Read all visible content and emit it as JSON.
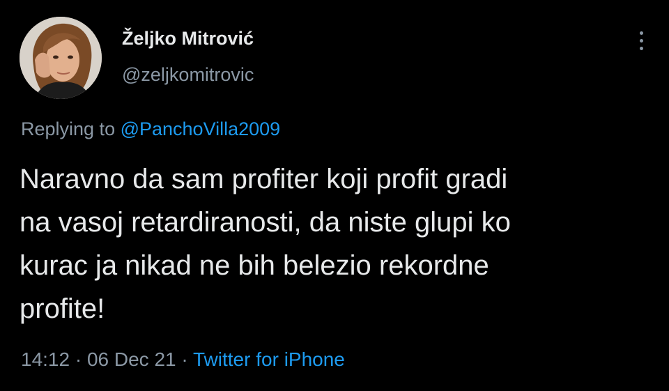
{
  "author": {
    "display_name": "Željko Mitrović",
    "handle": "@zeljkomitrovic"
  },
  "reply": {
    "prefix": "Replying to ",
    "mention": "@PanchoVilla2009"
  },
  "tweet": {
    "lines": [
      "Naravno da sam profiter koji profit gradi",
      "na vasoj retardiranosti, da niste glupi ko",
      "kurac ja nikad ne bih belezio rekordne",
      "profite!"
    ]
  },
  "meta": {
    "time": "14:12",
    "separator": " · ",
    "date": "06 Dec 21",
    "source": "Twitter for iPhone"
  },
  "icons": {
    "more": "more-vertical-icon"
  },
  "colors": {
    "background": "#000000",
    "text": "#e7e9ea",
    "secondary": "#8b98a5",
    "accent": "#1d9bf0"
  }
}
